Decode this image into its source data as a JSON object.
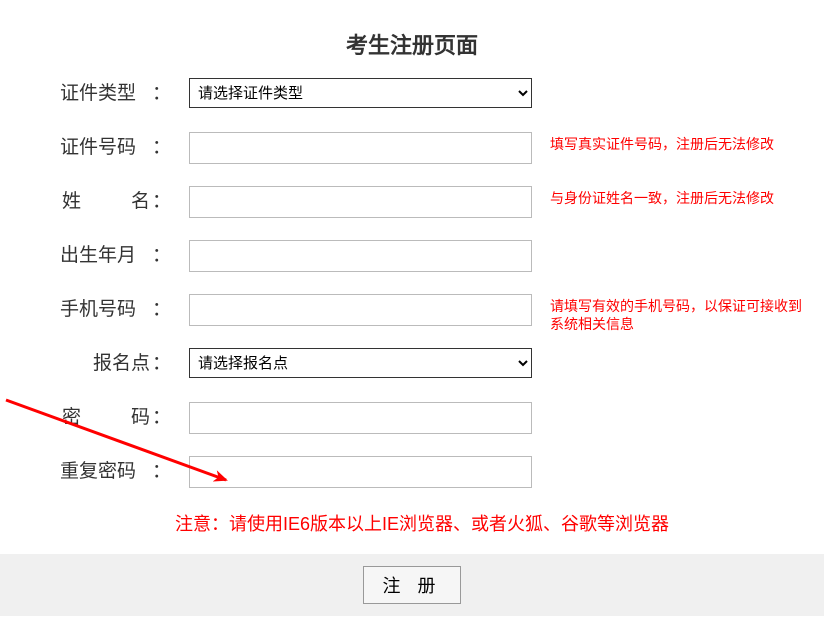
{
  "title": "考生注册页面",
  "fields": {
    "id_type": {
      "label": "证件类型",
      "placeholder": "请选择证件类型"
    },
    "id_number": {
      "label": "证件号码",
      "value": "",
      "hint": "填写真实证件号码，注册后无法修改"
    },
    "name": {
      "label_chars": [
        "姓",
        "名"
      ],
      "label": "姓　　名",
      "value": "",
      "hint": "与身份证姓名一致，注册后无法修改"
    },
    "birth": {
      "label": "出生年月",
      "value": ""
    },
    "phone": {
      "label": "手机号码",
      "value": "",
      "hint": "请填写有效的手机号码，以保证可接收到系统相关信息"
    },
    "site": {
      "label": "报名点",
      "placeholder": "请选择报名点"
    },
    "password": {
      "label_chars": [
        "密",
        "码"
      ],
      "label": "密　　码",
      "value": ""
    },
    "password2": {
      "label": "重复密码",
      "value": ""
    }
  },
  "notice_label": "注意：",
  "notice_text": "请使用IE6版本以上IE浏览器、或者火狐、谷歌等浏览器",
  "submit_label": "注 册",
  "colors": {
    "hint_color": "#ff0000"
  }
}
